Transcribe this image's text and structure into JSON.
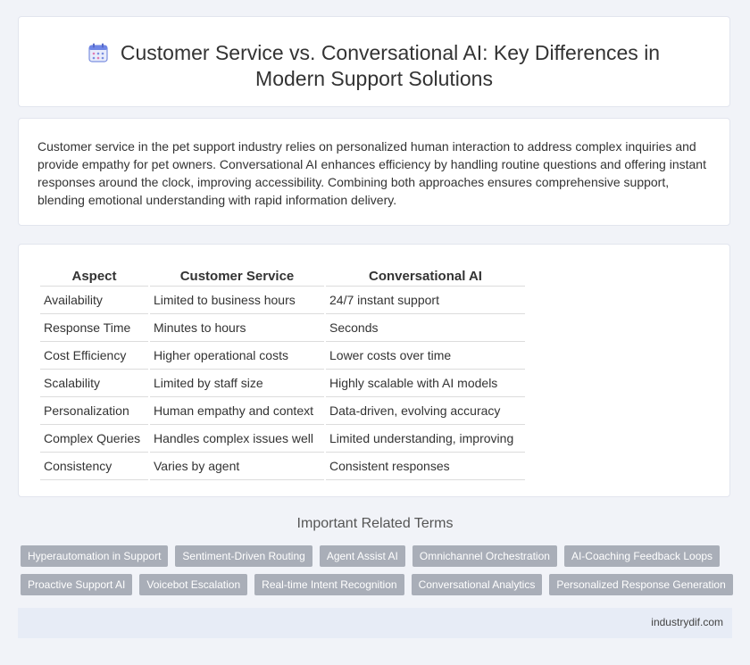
{
  "header": {
    "title": "Customer Service vs. Conversational AI: Key Differences in Modern Support Solutions",
    "icon": "calendar-icon"
  },
  "intro": {
    "text": "Customer service in the pet support industry relies on personalized human interaction to address complex inquiries and provide empathy for pet owners. Conversational AI enhances efficiency by handling routine questions and offering instant responses around the clock, improving accessibility. Combining both approaches ensures comprehensive support, blending emotional understanding with rapid information delivery."
  },
  "table": {
    "headers": [
      "Aspect",
      "Customer Service",
      "Conversational AI"
    ],
    "rows": [
      [
        "Availability",
        "Limited to business hours",
        "24/7 instant support"
      ],
      [
        "Response Time",
        "Minutes to hours",
        "Seconds"
      ],
      [
        "Cost Efficiency",
        "Higher operational costs",
        "Lower costs over time"
      ],
      [
        "Scalability",
        "Limited by staff size",
        "Highly scalable with AI models"
      ],
      [
        "Personalization",
        "Human empathy and context",
        "Data-driven, evolving accuracy"
      ],
      [
        "Complex Queries",
        "Handles complex issues well",
        "Limited understanding, improving"
      ],
      [
        "Consistency",
        "Varies by agent",
        "Consistent responses"
      ]
    ]
  },
  "related": {
    "title": "Important Related Terms",
    "tags": [
      "Hyperautomation in Support",
      "Sentiment-Driven Routing",
      "Agent Assist AI",
      "Omnichannel Orchestration",
      "AI-Coaching Feedback Loops",
      "Proactive Support AI",
      "Voicebot Escalation",
      "Real-time Intent Recognition",
      "Conversational Analytics",
      "Personalized Response Generation"
    ]
  },
  "footer": {
    "site": "industrydif.com"
  }
}
